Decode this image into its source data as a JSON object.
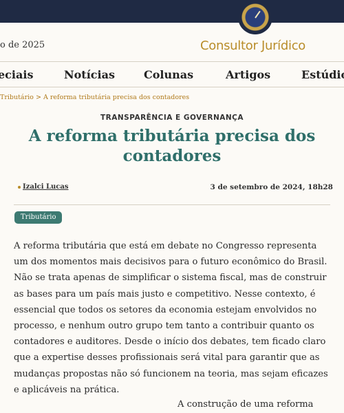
{
  "header": {
    "date_fragment": "o de 2025",
    "brand": "Consultor Jurídico",
    "logo": "conjur-compass-logo"
  },
  "nav": {
    "items": [
      "eciais",
      "Notícias",
      "Colunas",
      "Artigos",
      "Estúdio"
    ]
  },
  "breadcrumb": {
    "parent": "Tributário",
    "separator": ">",
    "current": "A reforma tributária precisa dos contadores"
  },
  "article": {
    "section": "TRANSPARÊNCIA E GOVERNANÇA",
    "title": "A reforma tributária precisa dos contadores",
    "author": "Izalci Lucas",
    "published": "3 de setembro de 2024, 18h28",
    "tag": "Tributário",
    "paragraph": "A reforma tributária que está em debate no Congresso representa um dos momentos mais decisivos para o futuro econômico do Brasil. Não se trata apenas de simplificar o sistema fiscal, mas de construir as bases para um país mais justo e competitivo. Nesse contexto, é essencial que todos os setores da economia estejam envolvidos no processo, e nenhum outro grupo tem tanto a contribuir quanto os contadores e auditores. Desde o início dos debates, tem ficado claro que a expertise desses profissionais será vital para garantir que as mudanças propostas não só funcionem na teoria, mas sejam eficazes e aplicáveis na prática.",
    "continuation": "A construção de uma reforma"
  }
}
